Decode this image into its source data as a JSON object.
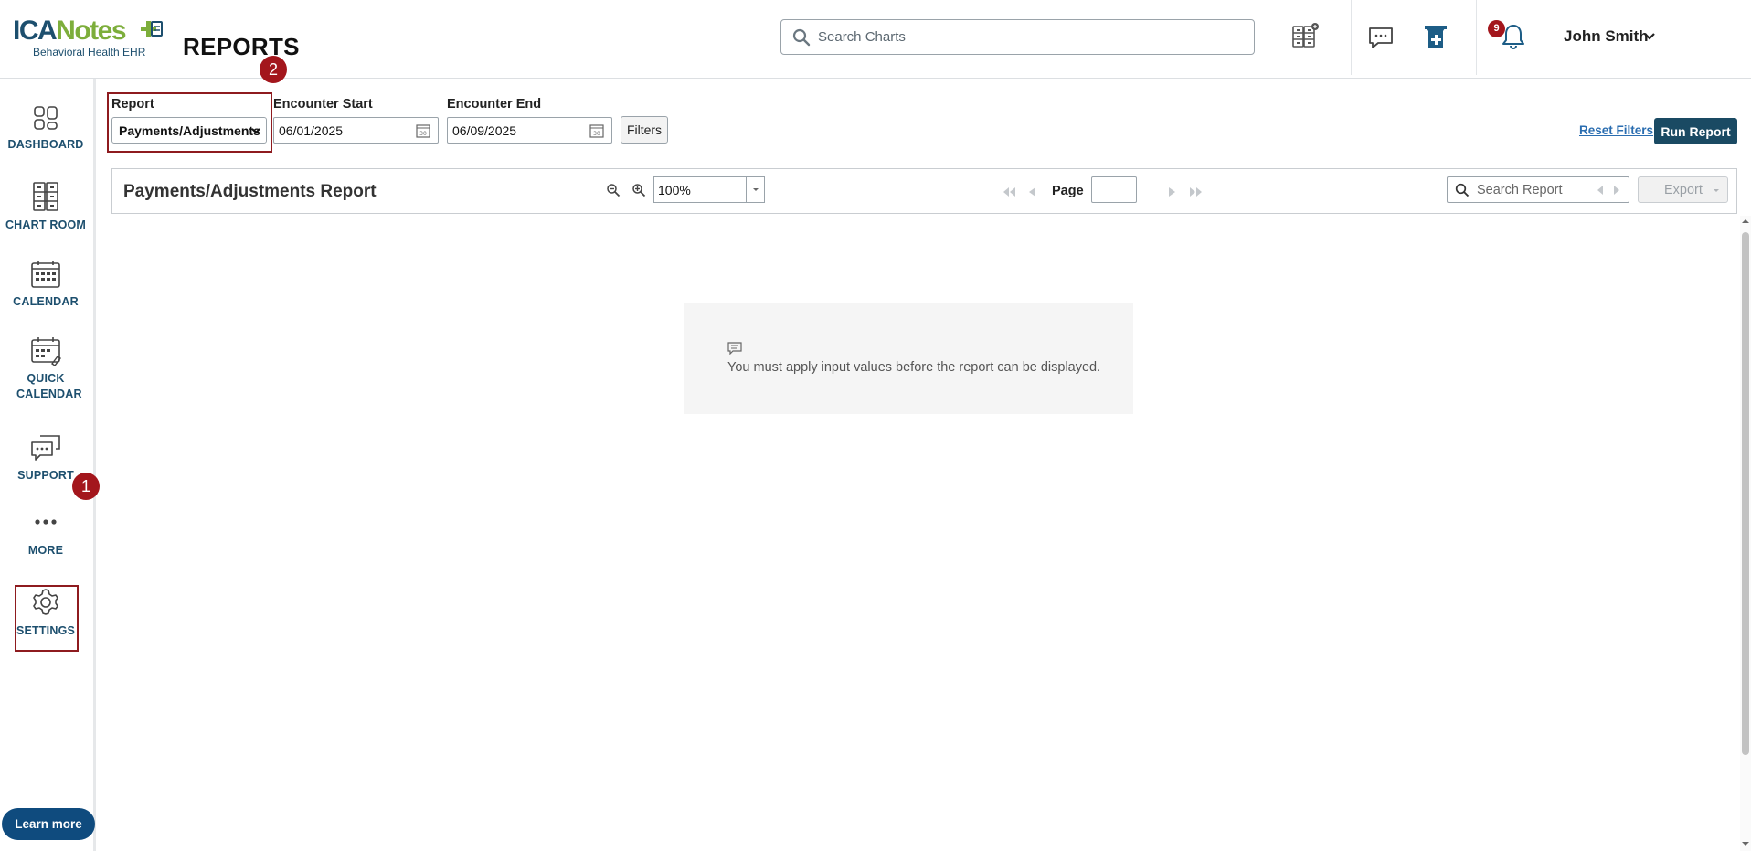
{
  "app": {
    "logo_primary_a": "ICA",
    "logo_primary_b": "Notes",
    "logo_subtitle": "Behavioral Health EHR",
    "page_title": "REPORTS"
  },
  "header": {
    "search_placeholder": "Search Charts",
    "notification_count": "9",
    "user_name": "John Smith"
  },
  "sidebar": {
    "items": [
      {
        "label": "DASHBOARD",
        "icon": "dashboard-icon"
      },
      {
        "label": "CHART ROOM",
        "icon": "chart-room-icon"
      },
      {
        "label": "CALENDAR",
        "icon": "calendar-icon"
      },
      {
        "label": "QUICK CALENDAR",
        "icon": "quick-calendar-icon"
      },
      {
        "label": "SUPPORT",
        "icon": "support-icon"
      },
      {
        "label": "MORE",
        "icon": "more-icon"
      },
      {
        "label": "SETTINGS",
        "icon": "gear-icon"
      }
    ],
    "learn_more_label": "Learn more"
  },
  "annotations": {
    "step1": "1",
    "step2": "2"
  },
  "filters": {
    "report_label": "Report",
    "report_value": "Payments/Adjustments",
    "encounter_start_label": "Encounter Start",
    "encounter_start_value": "06/01/2025",
    "encounter_end_label": "Encounter End",
    "encounter_end_value": "06/09/2025",
    "filters_button": "Filters",
    "reset_filters": "Reset Filters",
    "run_report": "Run Report"
  },
  "report": {
    "title": "Payments/Adjustments Report",
    "zoom_value": "100%",
    "page_label": "Page",
    "page_value": "",
    "search_placeholder": "Search Report",
    "export_label": "Export",
    "message": "You must apply input values before the report can be displayed."
  },
  "colors": {
    "brand_dark": "#1d4f6e",
    "brand_green": "#7dae3b",
    "highlight_red": "#a3161c",
    "run_button": "#1a4a63",
    "learn_more": "#0f4b7e"
  }
}
